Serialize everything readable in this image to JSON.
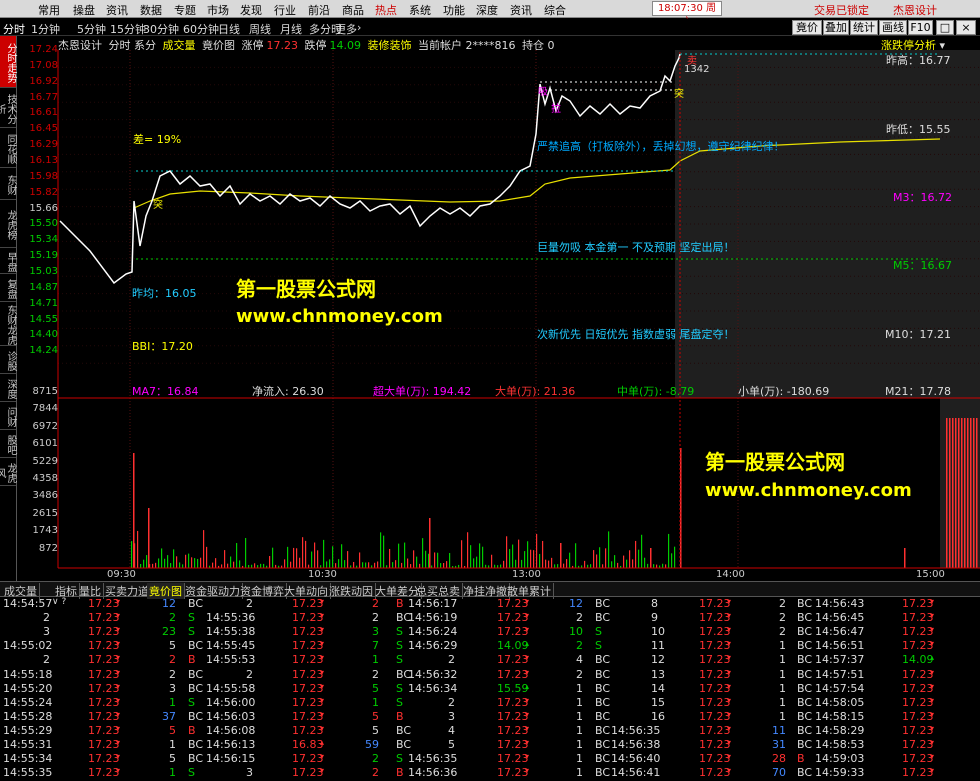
{
  "menu": {
    "items": [
      "常用",
      "操盘",
      "资讯",
      "数据",
      "专题",
      "市场",
      "发现",
      "行业",
      "前沿",
      "商品",
      "热点",
      "系统",
      "功能",
      "深度",
      "资讯",
      "综合"
    ],
    "active_index": 10,
    "clock": "18:07:30",
    "weekday": "周六",
    "lock_text": "交易已锁定",
    "brand": "杰恩设计"
  },
  "periods": {
    "items": [
      "分时",
      "1分钟",
      "5分钟",
      "15分钟",
      "30分钟",
      "60分钟",
      "日线",
      "周线",
      "月线",
      "多分时",
      "更多"
    ],
    "more_arrow": "›",
    "tools": [
      "竟价",
      "叠加",
      "统计",
      "画线",
      "F10"
    ],
    "win": [
      "□",
      "×"
    ]
  },
  "sidebar": {
    "tabs": [
      "分时走势",
      "技术分析",
      "同花顺",
      "东财",
      "龙虎榜",
      "早盘",
      "复盘",
      "东财龙虎",
      "诊股",
      "深度",
      "问财",
      "股吧",
      "龙虎风"
    ]
  },
  "info": {
    "stock": "杰恩设计",
    "mode": "分时 系分",
    "t1": "成交量",
    "t2": "竟价图",
    "label_zt": "涨停",
    "zt": "17.23",
    "label_dt": "跌停",
    "dt": "14.09",
    "industry": "装修装饰",
    "account": "当前帐户 2****816",
    "position": "持仓 0",
    "right_tag": "涨跌停分析"
  },
  "price_axis": [
    "17.24",
    "17.08",
    "16.92",
    "16.77",
    "16.61",
    "16.45",
    "16.29",
    "16.13",
    "15.98",
    "15.82",
    "15.66",
    "15.50",
    "15.34",
    "15.19",
    "15.03",
    "14.87",
    "14.71",
    "14.55",
    "14.40",
    "14.24"
  ],
  "volume_axis": [
    "8715",
    "7844",
    "6972",
    "6101",
    "5229",
    "4358",
    "3486",
    "2615",
    "1743",
    "872"
  ],
  "time_axis": [
    "09:30",
    "10:30",
    "13:00",
    "14:00",
    "15:00"
  ],
  "annotations": {
    "diff": "差= 19%",
    "prev_avg": "昨均：16.05",
    "bbi": "BBI：17.20",
    "ma7": "MA7：16.84",
    "net_inflow": "净流入: 26.30",
    "super_large": "超大单(万): 194.42",
    "large": "大单(万): 21.36",
    "medium": "中单(万): -8.79",
    "small": "小单(万): -180.69",
    "m21": "M21：17.78",
    "m10": "M10：17.21",
    "m5": "M5：16.67",
    "m3": "M3：16.72",
    "prev_high": "昨高：16.77",
    "prev_low": "昨低：15.55",
    "tip1": "严禁追高（打板除外），丢掉幻想，遵守纪律纪律！",
    "tip2": "巨量勿吸 本金第一 不及预期 坚定出局！",
    "tip3": "次新优先 日短优先 指数虚弱 尾盘定夺！",
    "vol_mark": "1342",
    "mark_tu": "突",
    "mark_xi": "吸",
    "mark_la": "拉",
    "mark_mai": "卖",
    "mark_s": "S"
  },
  "watermark": {
    "title": "第一股票公式网",
    "url": "www.chnmoney.com"
  },
  "bottom_tabs": [
    "成交量",
    "指标",
    "量比",
    "买卖力道",
    "竟价图",
    "资金驱动力",
    "资金博弈",
    "大单动向",
    "涨跌动因",
    "大单差分",
    "总买总卖",
    "净挂净撤",
    "散单累计"
  ],
  "bottom_active": 4,
  "colors": {
    "up": "#ff3030",
    "down": "#00cc00",
    "avg": "#e8e000",
    "price": "#ffffff",
    "accent": "#cc0000"
  },
  "trades": {
    "col1": [
      [
        "14:54:57",
        "17.23",
        "12",
        "BC"
      ],
      [
        "2",
        "17.23",
        "2",
        "S"
      ],
      [
        "3",
        "17.23",
        "23",
        "S"
      ],
      [
        "14:55:02",
        "17.23",
        "5",
        "BC"
      ],
      [
        "2",
        "17.23",
        "2",
        "B"
      ],
      [
        "14:55:18",
        "17.23",
        "2",
        "BC"
      ],
      [
        "14:55:20",
        "17.23",
        "3",
        "BC"
      ],
      [
        "14:55:24",
        "17.23",
        "1",
        "S"
      ],
      [
        "14:55:28",
        "17.23",
        "37",
        "BC"
      ],
      [
        "14:55:29",
        "17.23",
        "5",
        "B"
      ],
      [
        "14:55:31",
        "17.23",
        "1",
        "BC"
      ],
      [
        "14:55:34",
        "17.23",
        "5",
        "BC"
      ],
      [
        "14:55:35",
        "17.23",
        "1",
        "S"
      ]
    ],
    "col2": [
      [
        "2",
        "17.23",
        "2",
        "B"
      ],
      [
        "14:55:36",
        "17.23",
        "2",
        "BC"
      ],
      [
        "14:55:38",
        "17.23",
        "3",
        "S"
      ],
      [
        "14:55:45",
        "17.23",
        "7",
        "S"
      ],
      [
        "14:55:53",
        "17.23",
        "1",
        "S"
      ],
      [
        "2",
        "17.23",
        "2",
        "BC"
      ],
      [
        "14:55:58",
        "17.23",
        "5",
        "S"
      ],
      [
        "14:56:00",
        "17.23",
        "1",
        "S"
      ],
      [
        "14:56:03",
        "17.23",
        "5",
        "B"
      ],
      [
        "14:56:08",
        "17.23",
        "5",
        "BC"
      ],
      [
        "14:56:13",
        "16.83",
        "59",
        "BC"
      ],
      [
        "14:56:15",
        "17.23",
        "2",
        "S"
      ],
      [
        "3",
        "17.23",
        "2",
        "B"
      ]
    ],
    "col3": [
      [
        "14:56:17",
        "17.23",
        "12",
        "BC"
      ],
      [
        "14:56:19",
        "17.23",
        "2",
        "BC"
      ],
      [
        "14:56:24",
        "17.23",
        "10",
        "S"
      ],
      [
        "14:56:29",
        "14.09",
        "2",
        "S"
      ],
      [
        "2",
        "17.23",
        "4",
        "BC"
      ],
      [
        "14:56:32",
        "17.23",
        "2",
        "BC"
      ],
      [
        "14:56:34",
        "15.59",
        "1",
        "BC"
      ],
      [
        "2",
        "17.23",
        "1",
        "BC"
      ],
      [
        "3",
        "17.23",
        "1",
        "BC"
      ],
      [
        "4",
        "17.23",
        "1",
        "BC"
      ],
      [
        "5",
        "17.23",
        "1",
        "BC"
      ],
      [
        "14:56:35",
        "17.23",
        "1",
        "BC"
      ],
      [
        "14:56:36",
        "17.23",
        "1",
        "BC"
      ]
    ],
    "col4": [
      [
        "8",
        "17.23",
        "2",
        "BC"
      ],
      [
        "9",
        "17.23",
        "2",
        "BC"
      ],
      [
        "10",
        "17.23",
        "2",
        "BC"
      ],
      [
        "11",
        "17.23",
        "1",
        "BC"
      ],
      [
        "12",
        "17.23",
        "1",
        "BC"
      ],
      [
        "13",
        "17.23",
        "1",
        "BC"
      ],
      [
        "14",
        "17.23",
        "1",
        "BC"
      ],
      [
        "15",
        "17.23",
        "1",
        "BC"
      ],
      [
        "16",
        "17.23",
        "1",
        "BC"
      ],
      [
        "14:56:35",
        "17.23",
        "11",
        "BC"
      ],
      [
        "14:56:38",
        "17.23",
        "31",
        "BC"
      ],
      [
        "14:56:40",
        "17.23",
        "28",
        "B"
      ],
      [
        "14:56:41",
        "17.23",
        "70",
        "BC"
      ]
    ],
    "col5": [
      [
        "14:56:43",
        "17.23"
      ],
      [
        "14:56:45",
        "17.23"
      ],
      [
        "14:56:47",
        "17.23"
      ],
      [
        "14:56:51",
        "17.23"
      ],
      [
        "14:57:37",
        "14.09"
      ],
      [
        "14:57:51",
        "17.23"
      ],
      [
        "14:57:54",
        "17.23"
      ],
      [
        "14:58:05",
        "17.23"
      ],
      [
        "14:58:15",
        "17.23"
      ],
      [
        "14:58:29",
        "17.23"
      ],
      [
        "14:58:53",
        "17.23"
      ],
      [
        "14:59:03",
        "17.23"
      ],
      [
        "14:59:33",
        "17.23"
      ]
    ],
    "first_extra": "∨ ?"
  }
}
